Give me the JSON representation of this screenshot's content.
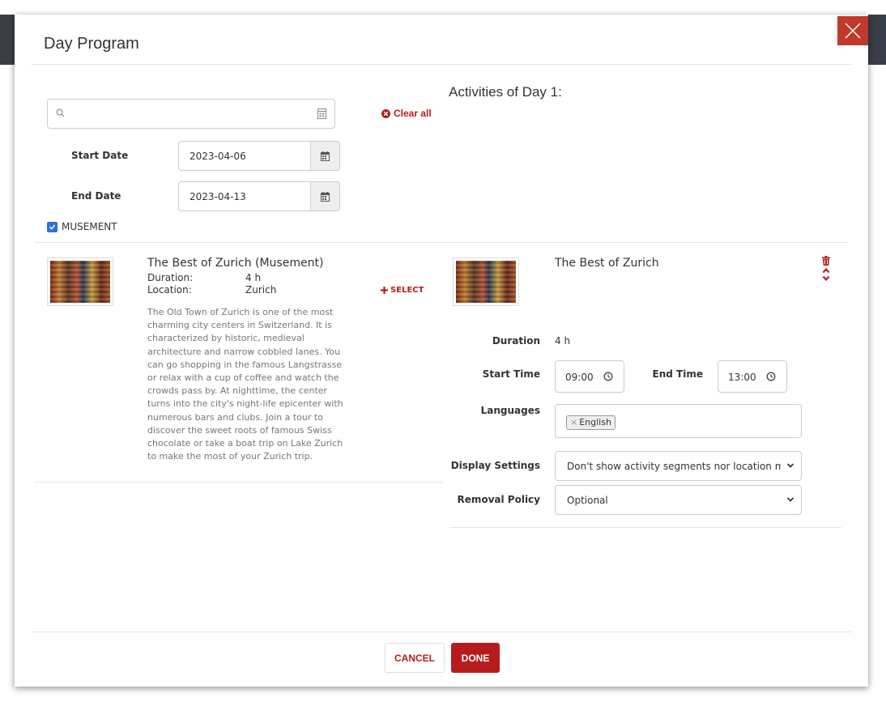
{
  "modal": {
    "title": "Day Program"
  },
  "search": {
    "value": "",
    "placeholder": ""
  },
  "clear_all_label": "Clear all",
  "filters": {
    "start_date_label": "Start Date",
    "start_date_value": "2023-04-06",
    "end_date_label": "End Date",
    "end_date_value": "2023-04-13",
    "provider_checkbox_label": "MUSEMENT",
    "provider_checked": true
  },
  "results": [
    {
      "name": "The Best of Zurich (Musement)",
      "duration_label": "Duration:",
      "duration_value": "4 h",
      "location_label": "Location:",
      "location_value": "Zurich",
      "select_label": "SELECT",
      "description": "The Old Town of Zurich is one of the most charming city centers in Switzerland. It is characterized by historic, medieval architecture and narrow cobbled lanes. You can go shopping in the famous Langstrasse or relax with a cup of coffee and watch the crowds pass by. At nighttime, the center turns into the city's night-life epicenter with numerous bars and clubs. Join a tour to discover the sweet roots of famous Swiss chocolate or take a boat trip on Lake Zurich to make the most of your Zurich trip."
    }
  ],
  "activities": {
    "heading": "Activities of Day 1:",
    "items": [
      {
        "name": "The Best of Zurich",
        "duration_label": "Duration",
        "duration_value": "4 h",
        "start_time_label": "Start Time",
        "start_time_value": "09:00",
        "end_time_label": "End Time",
        "end_time_value": "13:00",
        "languages_label": "Languages",
        "languages": [
          "English"
        ],
        "display_settings_label": "Display Settings",
        "display_settings_value": "Don't show activity segments nor location map",
        "removal_policy_label": "Removal Policy",
        "removal_policy_value": "Optional"
      }
    ]
  },
  "footer": {
    "cancel_label": "CANCEL",
    "done_label": "DONE"
  },
  "colors": {
    "accent": "#b71c1c",
    "close_bg": "#c0392b",
    "checkbox": "#2f6fd6"
  },
  "icons": {
    "search": "search-icon",
    "calendar": "calendar-icon",
    "clear": "times-circle-icon",
    "plus": "plus-icon",
    "trash": "trash-icon",
    "up": "chevron-up-icon",
    "down": "chevron-down-icon",
    "clock": "clock-icon",
    "close": "close-icon"
  }
}
